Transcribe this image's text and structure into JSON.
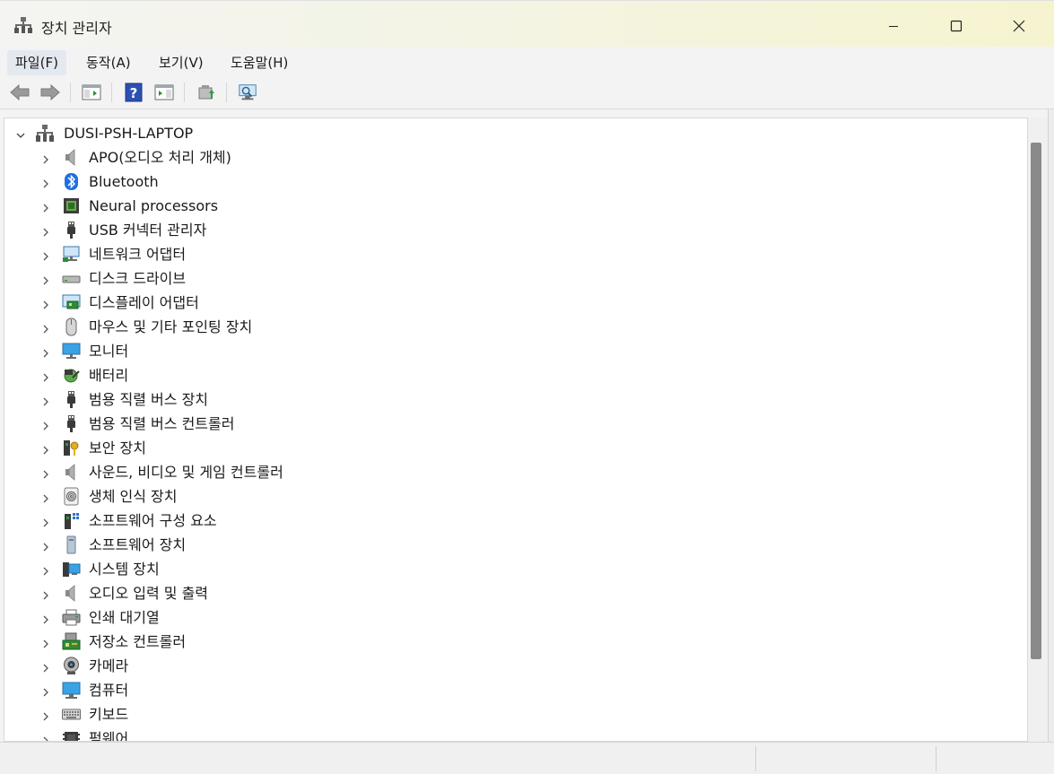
{
  "window": {
    "title": "장치 관리자",
    "icon": "device-manager-icon"
  },
  "menu": [
    {
      "label": "파일(F)",
      "active": true
    },
    {
      "label": "동작(A)",
      "active": false
    },
    {
      "label": "보기(V)",
      "active": false
    },
    {
      "label": "도움말(H)",
      "active": false
    }
  ],
  "toolbar": [
    {
      "name": "back-button",
      "icon": "arrow-left-icon"
    },
    {
      "name": "forward-button",
      "icon": "arrow-right-icon"
    },
    {
      "name": "show-hide-console-tree-button",
      "icon": "console-tree-icon"
    },
    {
      "name": "help-button",
      "icon": "help-icon"
    },
    {
      "name": "action-pane-button",
      "icon": "action-pane-icon"
    },
    {
      "name": "update-driver-button",
      "icon": "update-driver-icon"
    },
    {
      "name": "scan-hardware-button",
      "icon": "monitor-scan-icon"
    }
  ],
  "tree": {
    "root": {
      "label": "DUSI-PSH-LAPTOP",
      "expanded": true,
      "icon": "computer-root-icon"
    },
    "items": [
      {
        "label": "APO(오디오 처리 개체)",
        "icon": "speaker-icon"
      },
      {
        "label": "Bluetooth",
        "icon": "bluetooth-icon"
      },
      {
        "label": "Neural processors",
        "icon": "chip-icon"
      },
      {
        "label": "USB 커넥터 관리자",
        "icon": "usb-plug-icon"
      },
      {
        "label": "네트워크 어댑터",
        "icon": "network-adapter-icon"
      },
      {
        "label": "디스크 드라이브",
        "icon": "disk-drive-icon"
      },
      {
        "label": "디스플레이 어댑터",
        "icon": "display-adapter-icon"
      },
      {
        "label": "마우스 및 기타 포인팅 장치",
        "icon": "mouse-icon"
      },
      {
        "label": "모니터",
        "icon": "monitor-icon"
      },
      {
        "label": "배터리",
        "icon": "battery-icon"
      },
      {
        "label": "범용 직렬 버스 장치",
        "icon": "usb-plug-icon"
      },
      {
        "label": "범용 직렬 버스 컨트롤러",
        "icon": "usb-plug-icon"
      },
      {
        "label": "보안 장치",
        "icon": "security-key-icon"
      },
      {
        "label": "사운드, 비디오 및 게임 컨트롤러",
        "icon": "speaker-icon"
      },
      {
        "label": "생체 인식 장치",
        "icon": "fingerprint-icon"
      },
      {
        "label": "소프트웨어 구성 요소",
        "icon": "software-component-icon"
      },
      {
        "label": "소프트웨어 장치",
        "icon": "software-device-icon"
      },
      {
        "label": "시스템 장치",
        "icon": "system-device-icon"
      },
      {
        "label": "오디오 입력 및 출력",
        "icon": "speaker-icon"
      },
      {
        "label": "인쇄 대기열",
        "icon": "printer-icon"
      },
      {
        "label": "저장소 컨트롤러",
        "icon": "storage-controller-icon"
      },
      {
        "label": "카메라",
        "icon": "camera-icon"
      },
      {
        "label": "컴퓨터",
        "icon": "computer-icon"
      },
      {
        "label": "키보드",
        "icon": "keyboard-icon"
      },
      {
        "label": "펌웨어",
        "icon": "firmware-icon"
      }
    ]
  }
}
